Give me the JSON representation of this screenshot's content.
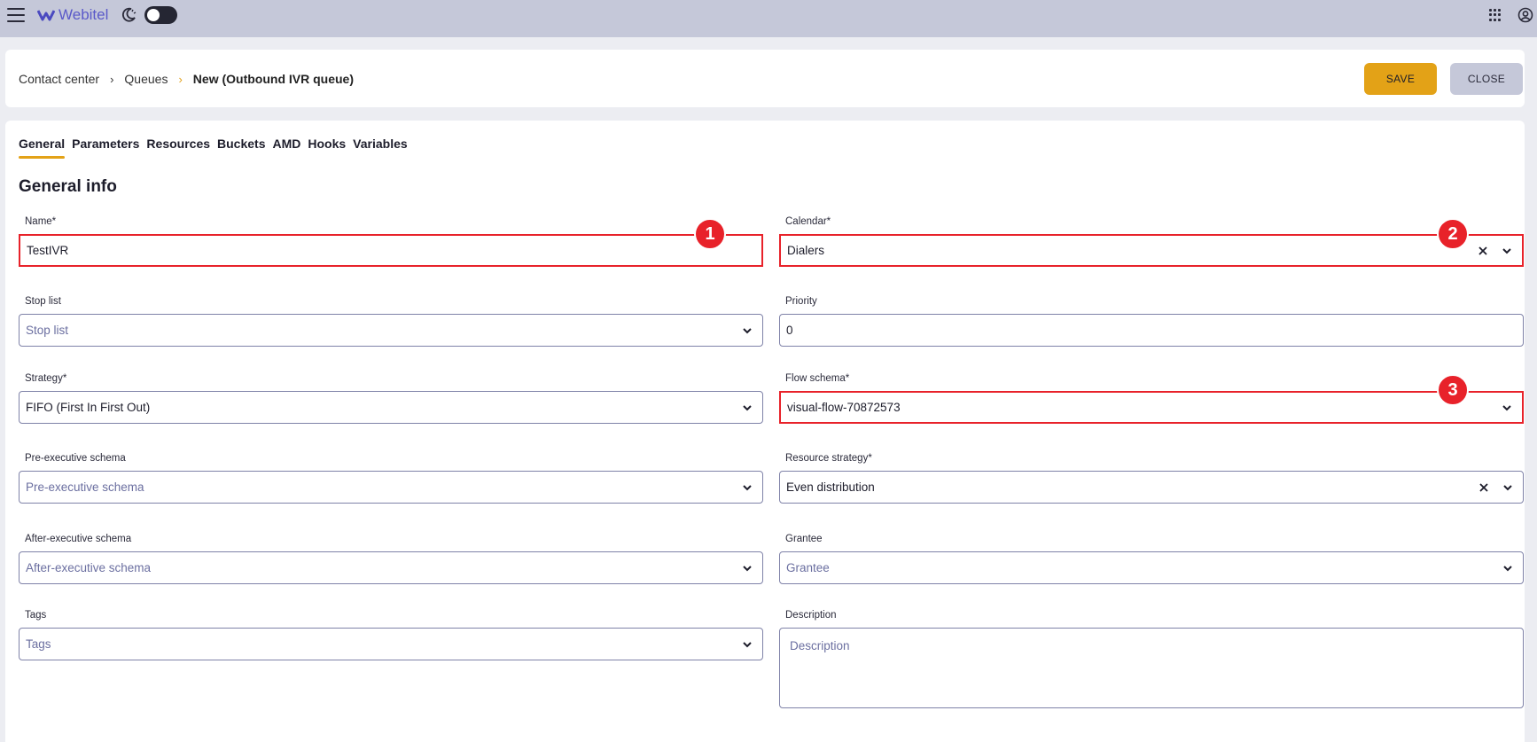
{
  "app": {
    "name": "Webitel"
  },
  "breadcrumb": {
    "item1": "Contact center",
    "item2": "Queues",
    "current": "New (Outbound IVR queue)"
  },
  "actions": {
    "save": "SAVE",
    "close": "CLOSE"
  },
  "tabs": [
    {
      "label": "General"
    },
    {
      "label": "Parameters"
    },
    {
      "label": "Resources"
    },
    {
      "label": "Buckets"
    },
    {
      "label": "AMD"
    },
    {
      "label": "Hooks"
    },
    {
      "label": "Variables"
    }
  ],
  "section": {
    "title": "General info"
  },
  "fields": {
    "name": {
      "label": "Name*",
      "value": "TestIVR"
    },
    "calendar": {
      "label": "Calendar*",
      "value": "Dialers"
    },
    "stop_list": {
      "label": "Stop list",
      "placeholder": "Stop list"
    },
    "priority": {
      "label": "Priority",
      "value": "0"
    },
    "strategy": {
      "label": "Strategy*",
      "value": "FIFO (First In First Out)"
    },
    "flow_schema": {
      "label": "Flow schema*",
      "value": "visual-flow-70872573"
    },
    "pre_exec": {
      "label": "Pre-executive schema",
      "placeholder": "Pre-executive schema"
    },
    "resource_strategy": {
      "label": "Resource strategy*",
      "value": "Even distribution"
    },
    "after_exec": {
      "label": "After-executive schema",
      "placeholder": "After-executive schema"
    },
    "grantee": {
      "label": "Grantee",
      "placeholder": "Grantee"
    },
    "tags": {
      "label": "Tags",
      "placeholder": "Tags"
    },
    "description": {
      "label": "Description",
      "placeholder": "Description"
    }
  },
  "annotations": {
    "b1": "1",
    "b2": "2",
    "b3": "3"
  },
  "colors": {
    "accent": "#e3a217",
    "highlight": "#e8222a",
    "topbar": "#c5c8d9"
  }
}
